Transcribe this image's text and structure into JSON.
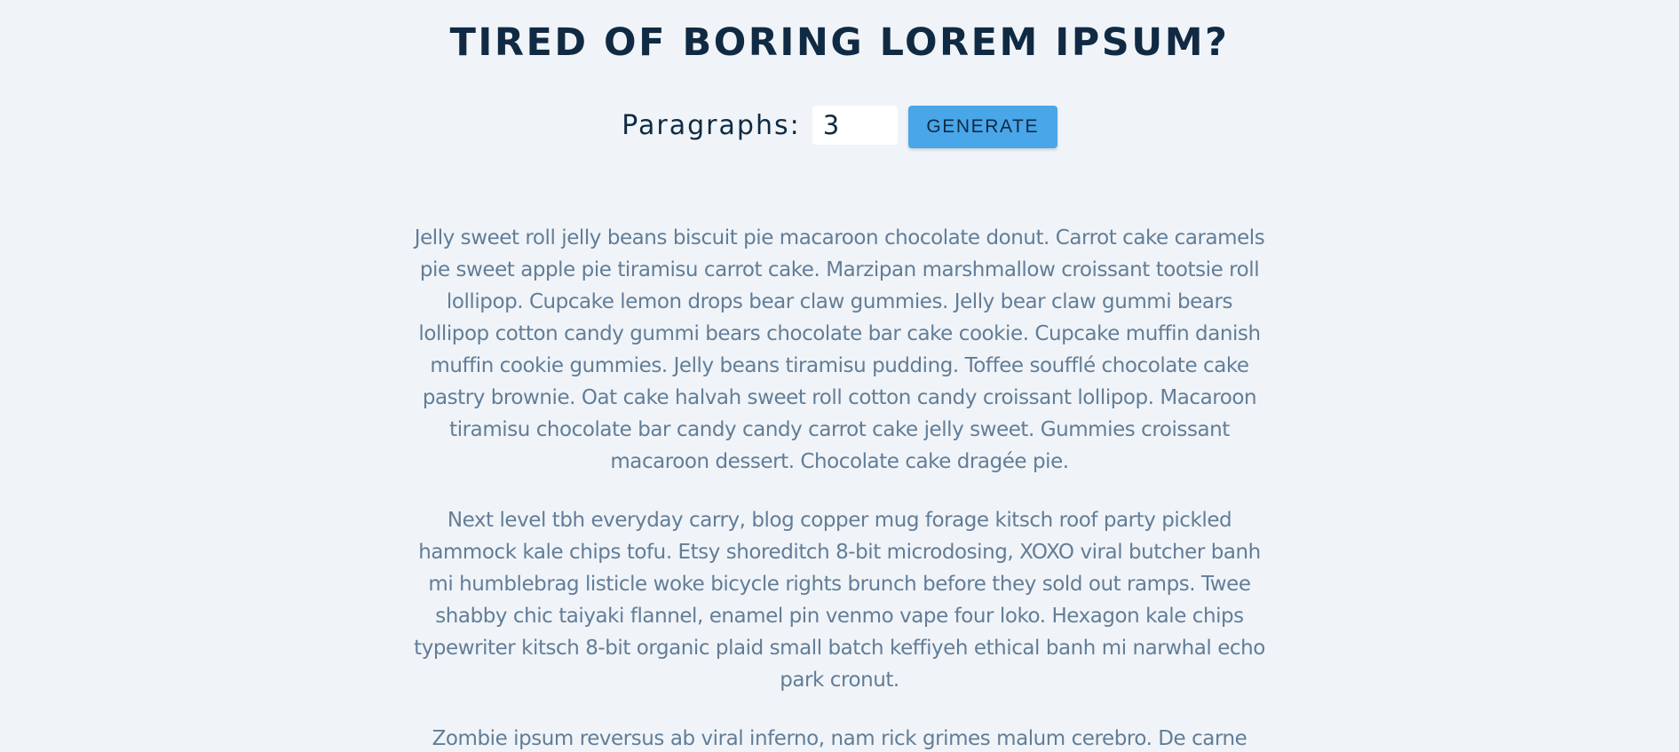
{
  "header": {
    "title": "TIRED OF BORING LOREM IPSUM?"
  },
  "form": {
    "label": "Paragraphs:",
    "amount_value": "3",
    "button_label": "generate"
  },
  "paragraphs": [
    "Jelly sweet roll jelly beans biscuit pie macaroon chocolate donut. Carrot cake caramels pie sweet apple pie tiramisu carrot cake. Marzipan marshmallow croissant tootsie roll lollipop. Cupcake lemon drops bear claw gummies. Jelly bear claw gummi bears lollipop cotton candy gummi bears chocolate bar cake cookie. Cupcake muffin danish muffin cookie gummies. Jelly beans tiramisu pudding. Toffee soufflé chocolate cake pastry brownie. Oat cake halvah sweet roll cotton candy croissant lollipop. Macaroon tiramisu chocolate bar candy candy carrot cake jelly sweet. Gummies croissant macaroon dessert. Chocolate cake dragée pie.",
    "Next level tbh everyday carry, blog copper mug forage kitsch roof party pickled hammock kale chips tofu. Etsy shoreditch 8-bit microdosing, XOXO viral butcher banh mi humblebrag listicle woke bicycle rights brunch before they sold out ramps. Twee shabby chic taiyaki flannel, enamel pin venmo vape four loko. Hexagon kale chips typewriter kitsch 8-bit organic plaid small batch keffiyeh ethical banh mi narwhal echo park cronut.",
    "Zombie ipsum reversus ab viral inferno, nam rick grimes malum cerebro. De carne lumbering animata corpora quaeritis. Summus brains sit, morbo vel maleficia? De"
  ],
  "colors": {
    "background": "#f0f4f8",
    "title": "#102a43",
    "body_text": "#627d98",
    "button": "#49a6e9"
  }
}
